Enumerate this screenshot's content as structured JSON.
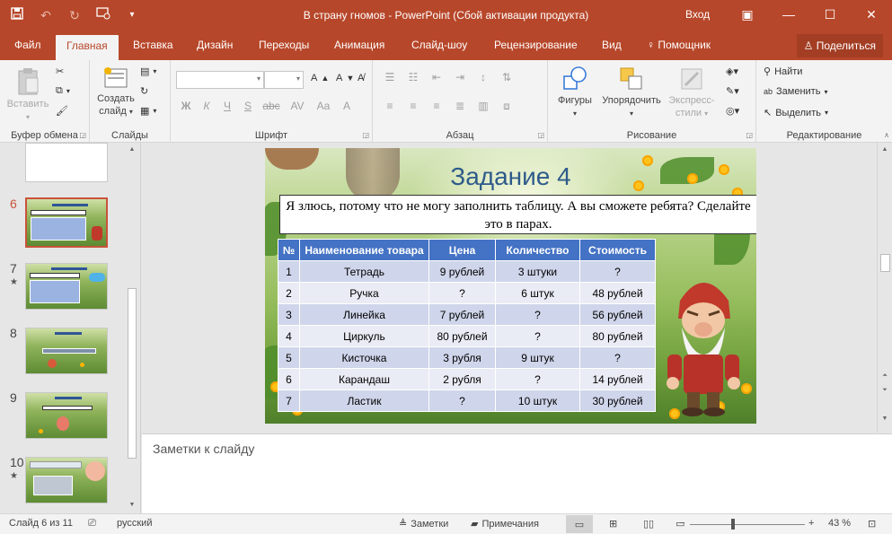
{
  "window": {
    "title": "В страну гномов  -  PowerPoint (Сбой активации продукта)",
    "login": "Вход"
  },
  "tabs": [
    "Файл",
    "Главная",
    "Вставка",
    "Дизайн",
    "Переходы",
    "Анимация",
    "Слайд-шоу",
    "Рецензирование",
    "Вид",
    "Помощник"
  ],
  "active_tab": "Главная",
  "share_label": "Поделиться",
  "ribbon": {
    "clipboard": {
      "label": "Буфер обмена",
      "paste": "Вставить"
    },
    "slides": {
      "label": "Слайды",
      "new_slide_1": "Создать",
      "new_slide_2": "слайд"
    },
    "font": {
      "label": "Шрифт",
      "format_buttons": [
        "Ж",
        "К",
        "Ч",
        "S",
        "abc",
        "AV",
        "Aa",
        "A"
      ]
    },
    "paragraph": {
      "label": "Абзац"
    },
    "drawing": {
      "label": "Рисование",
      "shapes": "Фигуры",
      "arrange": "Упорядочить",
      "quick_styles_1": "Экспресс-",
      "quick_styles_2": "стили"
    },
    "editing": {
      "label": "Редактирование",
      "find": "Найти",
      "replace": "Заменить",
      "select": "Выделить"
    }
  },
  "thumbnails": [
    {
      "num": "6",
      "star": ""
    },
    {
      "num": "7",
      "star": "★"
    },
    {
      "num": "8",
      "star": ""
    },
    {
      "num": "9",
      "star": ""
    },
    {
      "num": "10",
      "star": "★"
    }
  ],
  "slide": {
    "title": "Задание 4",
    "text": "Я злюсь, потому что не могу заполнить таблицу. А вы сможете ребята? Сделайте это в парах.",
    "table": {
      "headers": [
        "№",
        "Наименование товара",
        "Цена",
        "Количество",
        "Стоимость"
      ],
      "rows": [
        [
          "1",
          "Тетрадь",
          "9 рублей",
          "3 штуки",
          "?"
        ],
        [
          "2",
          "Ручка",
          "?",
          "6 штук",
          "48 рублей"
        ],
        [
          "3",
          "Линейка",
          "7 рублей",
          "?",
          "56 рублей"
        ],
        [
          "4",
          "Циркуль",
          "80 рублей",
          "?",
          "80 рублей"
        ],
        [
          "5",
          "Кисточка",
          "3 рубля",
          "9 штук",
          "?"
        ],
        [
          "6",
          "Карандаш",
          "2 рубля",
          "?",
          "14 рублей"
        ],
        [
          "7",
          "Ластик",
          "?",
          "10 штук",
          "30 рублей"
        ]
      ]
    }
  },
  "notes_placeholder": "Заметки к слайду",
  "status": {
    "slide_counter": "Слайд 6 из 11",
    "language": "русский",
    "notes": "Заметки",
    "comments": "Примечания",
    "zoom": "43 %"
  }
}
